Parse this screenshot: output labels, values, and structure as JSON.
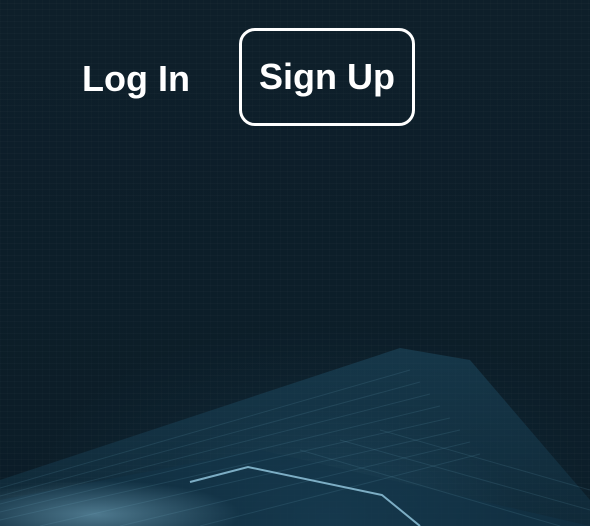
{
  "header": {
    "login_label": "Log In",
    "signup_label": "Sign Up"
  },
  "colors": {
    "background": "#0c1e29",
    "text": "#ffffff",
    "glow": "#2c6280",
    "line_highlight": "#8fc3da"
  }
}
